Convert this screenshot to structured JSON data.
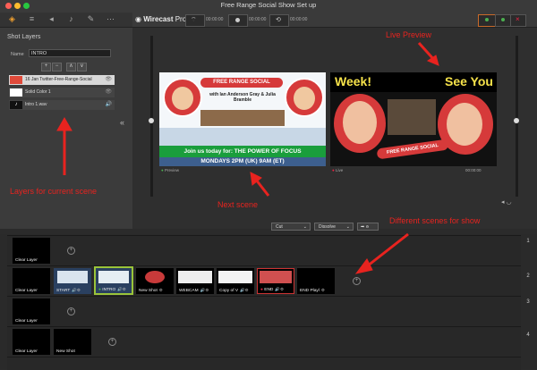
{
  "window": {
    "title": "Free Range Social Show Set up"
  },
  "left_panel": {
    "title": "Shot Layers",
    "name_label": "Name",
    "name_value": "INTRO",
    "layers": [
      {
        "label": "16 Jan Twitter-Free-Range-Social"
      },
      {
        "label": "Solid Color 1"
      },
      {
        "label": "Intro 1.wav"
      }
    ]
  },
  "header": {
    "brand_main": "Wirecast",
    "brand_sub": " Pro",
    "timecode_1": "00:00:00",
    "timecode_2": "00:00:00",
    "timecode_3": "00:00:00"
  },
  "preview": {
    "label": "Preview",
    "banner": "FREE RANGE SOCIAL",
    "with_text": "with Ian Anderson Gray & Julia Bramble",
    "join_text": "Join us today for: THE POWER OF FOCUS",
    "time_text": "MONDAYS 2PM (UK) 9AM (ET)"
  },
  "live": {
    "label": "Live",
    "week_text": "Week!",
    "see_you_text": "See You",
    "banner": "FREE RANGE SOCIAL",
    "timecode": "00:00:00"
  },
  "controls": {
    "cut": "Cut",
    "transition": "Dissolve"
  },
  "rows": [
    {
      "num": "1",
      "shots": [
        {
          "label": "Clear Layer"
        }
      ]
    },
    {
      "num": "2",
      "shots": [
        {
          "label": "Clear Layer"
        },
        {
          "label": "START"
        },
        {
          "label": "INTRO"
        },
        {
          "label": "New Shot"
        },
        {
          "label": "WEBCAM"
        },
        {
          "label": "Copy of V"
        },
        {
          "label": "END"
        },
        {
          "label": "END Playl"
        }
      ]
    },
    {
      "num": "3",
      "shots": [
        {
          "label": "Clear Layer"
        }
      ]
    },
    {
      "num": "4",
      "shots": [
        {
          "label": "Clear Layer"
        },
        {
          "label": "New Shot"
        }
      ]
    }
  ],
  "annotations": {
    "live_preview": "Live Preview",
    "layers": "Layers for current scene",
    "next_scene": "Next scene",
    "different_scenes": "Different scenes for show"
  },
  "colors": {
    "annotation": "#e8231f",
    "intro_highlight": "#9ac43a",
    "banner_red": "#d63a3a",
    "join_green": "#1a9e3c"
  }
}
